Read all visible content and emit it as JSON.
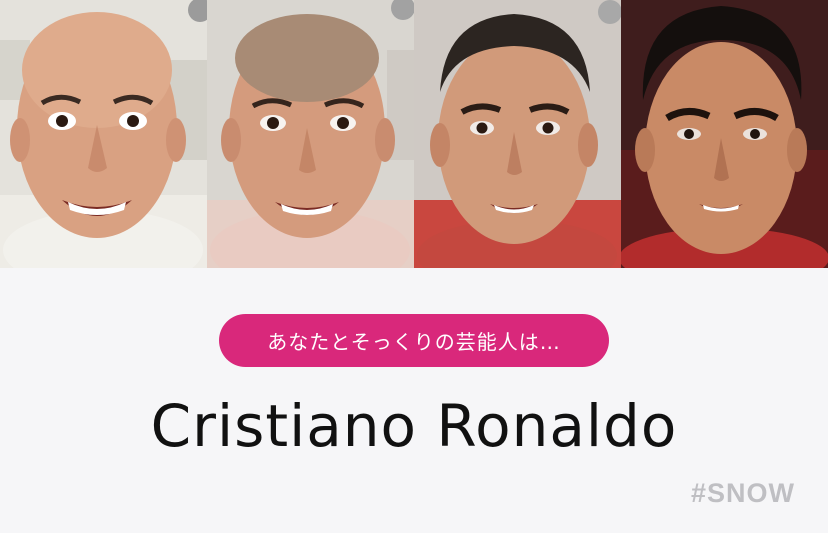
{
  "morph_sequence": {
    "frames": [
      {
        "label": "",
        "stage": "original-face"
      },
      {
        "label": "",
        "stage": "morph-1"
      },
      {
        "label": "",
        "stage": "morph-2"
      },
      {
        "label": "",
        "stage": "celebrity-face"
      }
    ]
  },
  "result": {
    "prompt": "あなたとそっくりの芸能人は…",
    "celebrity_name": "Cristiano Ronaldo",
    "hashtag": "#SNOW"
  },
  "colors": {
    "accent_pill": "#d9287b",
    "name_text": "#111111",
    "hashtag_text": "#bfbfc3",
    "background": "#f6f6f8"
  }
}
